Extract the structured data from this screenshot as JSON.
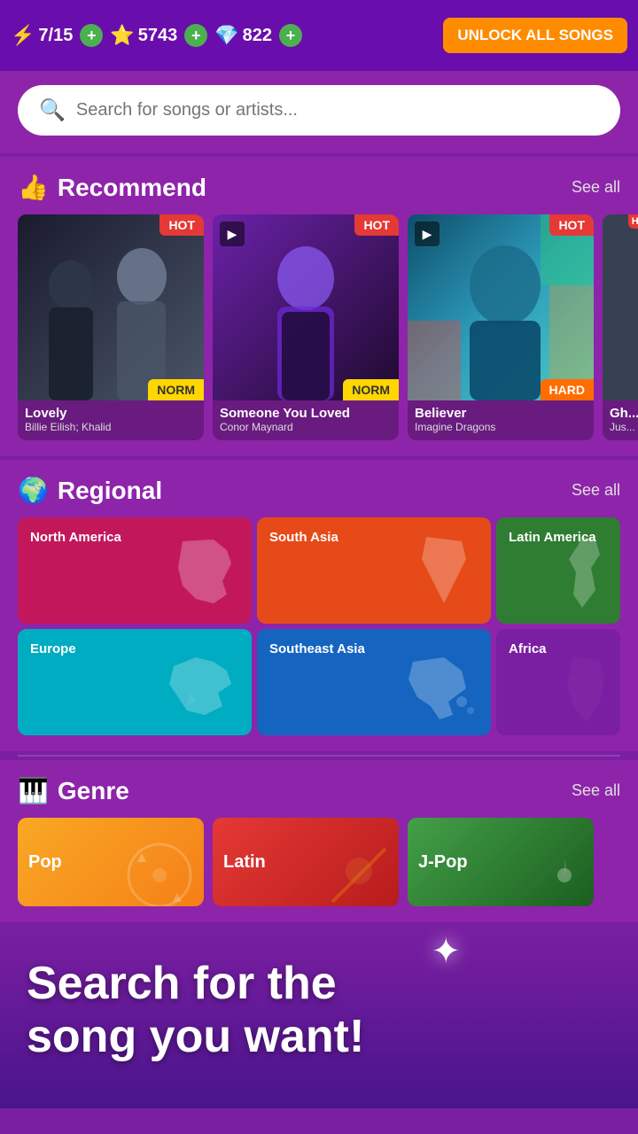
{
  "topbar": {
    "lives_current": "7",
    "lives_total": "15",
    "lives_display": "7/15",
    "stars": "5743",
    "diamonds": "822",
    "unlock_btn": "UNLOCK ALL SONGS",
    "plus_label": "+"
  },
  "search": {
    "placeholder": "Search for songs or artists..."
  },
  "recommend": {
    "title": "Recommend",
    "see_all": "See all",
    "songs": [
      {
        "name": "Lovely",
        "artist": "Billie Eilish; Khalid",
        "hot": "HOT",
        "diff": "NORM",
        "diff_class": "diff-norm",
        "card_class": "card-lovely"
      },
      {
        "name": "Someone You Loved",
        "artist": "Conor Maynard",
        "hot": "HOT",
        "diff": "NORM",
        "diff_class": "diff-norm",
        "card_class": "card-someone",
        "has_play": true
      },
      {
        "name": "Believer",
        "artist": "Imagine Dragons",
        "hot": "HOT",
        "diff": "HARD",
        "diff_class": "diff-hard",
        "card_class": "card-believer",
        "has_play": true
      },
      {
        "name": "Gh...",
        "artist": "Jus...",
        "hot": "HOT",
        "diff": "",
        "card_class": "card-partial",
        "partial": true
      }
    ]
  },
  "regional": {
    "title": "Regional",
    "see_all": "See all",
    "regions": [
      {
        "name": "North America",
        "class": "region-north-america"
      },
      {
        "name": "South Asia",
        "class": "region-south-asia"
      },
      {
        "name": "Latin America",
        "class": "region-latin-america"
      },
      {
        "name": "Europe",
        "class": "region-europe"
      },
      {
        "name": "Southeast Asia",
        "class": "region-southeast-asia"
      },
      {
        "name": "Africa",
        "class": "region-africa"
      }
    ]
  },
  "genre": {
    "title": "Genre",
    "title_icon": "🎹",
    "see_all": "See all",
    "genres": [
      {
        "name": "Pop",
        "class": "genre-pop"
      },
      {
        "name": "Latin",
        "class": "genre-latin"
      },
      {
        "name": "J-Pop",
        "class": "genre-jpop"
      }
    ]
  },
  "bottom_banner": {
    "line1": "Search for the",
    "line2": "song you want!"
  }
}
